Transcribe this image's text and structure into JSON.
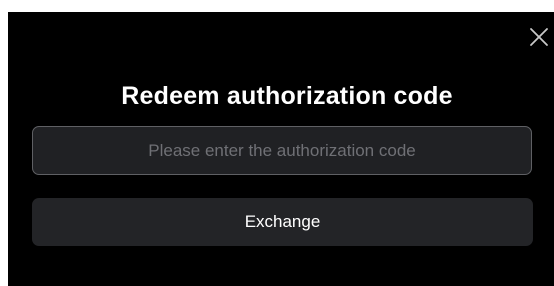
{
  "dialog": {
    "title": "Redeem authorization code",
    "close_icon": "close-icon",
    "code_input": {
      "value": "",
      "placeholder": "Please enter the authorization code"
    },
    "exchange_label": "Exchange"
  },
  "colors": {
    "dialog_background": "#000000",
    "input_background": "#202124",
    "input_border": "#5f6064",
    "button_background": "#232427",
    "text": "#ffffff",
    "placeholder": "#6f7075"
  }
}
